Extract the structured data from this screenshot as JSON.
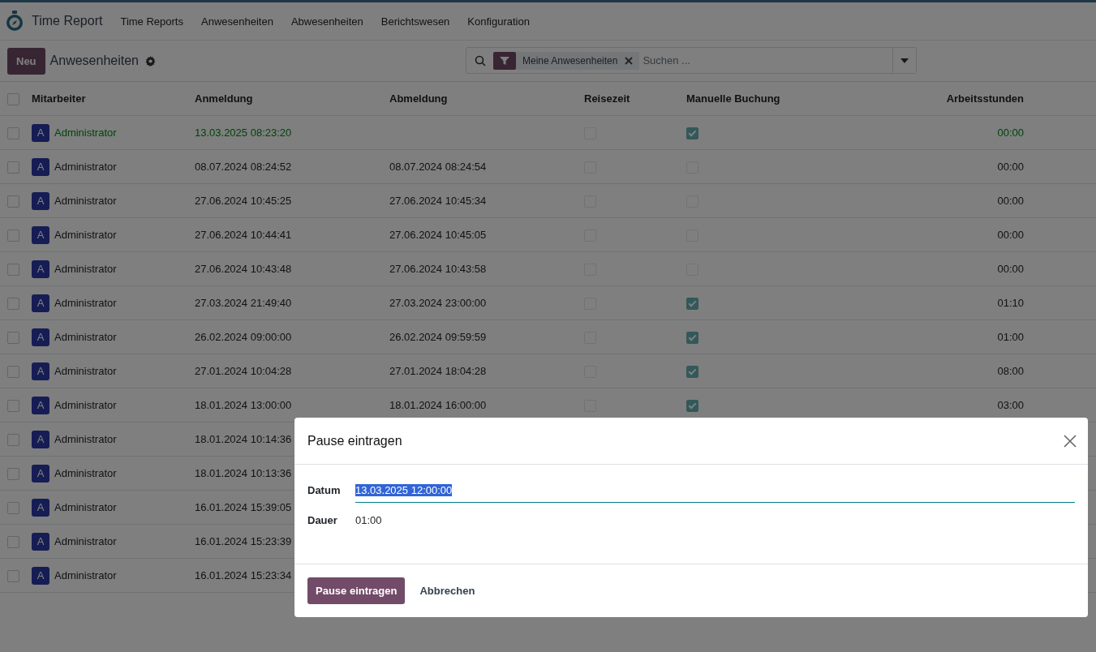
{
  "app": {
    "title": "Time Report"
  },
  "menu": [
    "Time Reports",
    "Anwesenheiten",
    "Abwesenheiten",
    "Berichtswesen",
    "Konfiguration"
  ],
  "control_panel": {
    "new_button": "Neu",
    "title": "Anwesenheiten"
  },
  "search": {
    "facet": "Meine Anwesenheiten",
    "placeholder": "Suchen ..."
  },
  "table": {
    "select_all": false,
    "columns": [
      "Mitarbeiter",
      "Anmeldung",
      "Abmeldung",
      "Reisezeit",
      "Manuelle Buchung",
      "Arbeitsstunden"
    ],
    "rows": [
      {
        "selected": false,
        "avatar": "A",
        "employee": "Administrator",
        "check_in": "13.03.2025 08:23:20",
        "travel": false,
        "manual": true,
        "hours": "00:00",
        "active": true
      },
      {
        "selected": false,
        "avatar": "A",
        "employee": "Administrator",
        "check_in": "08.07.2024 08:24:52",
        "check_out": "08.07.2024 08:24:54",
        "travel": false,
        "manual": false,
        "hours": "00:00",
        "active": false
      },
      {
        "selected": false,
        "avatar": "A",
        "employee": "Administrator",
        "check_in": "27.06.2024 10:45:25",
        "check_out": "27.06.2024 10:45:34",
        "travel": false,
        "manual": false,
        "hours": "00:00",
        "active": false
      },
      {
        "selected": false,
        "avatar": "A",
        "employee": "Administrator",
        "check_in": "27.06.2024 10:44:41",
        "check_out": "27.06.2024 10:45:05",
        "travel": false,
        "manual": false,
        "hours": "00:00",
        "active": false
      },
      {
        "selected": false,
        "avatar": "A",
        "employee": "Administrator",
        "check_in": "27.06.2024 10:43:48",
        "check_out": "27.06.2024 10:43:58",
        "travel": false,
        "manual": false,
        "hours": "00:00",
        "active": false
      },
      {
        "selected": false,
        "avatar": "A",
        "employee": "Administrator",
        "check_in": "27.03.2024 21:49:40",
        "check_out": "27.03.2024 23:00:00",
        "travel": false,
        "manual": true,
        "hours": "01:10",
        "active": false
      },
      {
        "selected": false,
        "avatar": "A",
        "employee": "Administrator",
        "check_in": "26.02.2024 09:00:00",
        "check_out": "26.02.2024 09:59:59",
        "travel": false,
        "manual": true,
        "hours": "01:00",
        "active": false
      },
      {
        "selected": false,
        "avatar": "A",
        "employee": "Administrator",
        "check_in": "27.01.2024 10:04:28",
        "check_out": "27.01.2024 18:04:28",
        "travel": false,
        "manual": true,
        "hours": "08:00",
        "active": false
      },
      {
        "selected": false,
        "avatar": "A",
        "employee": "Administrator",
        "check_in": "18.01.2024 13:00:00",
        "check_out": "18.01.2024 16:00:00",
        "travel": false,
        "manual": true,
        "hours": "03:00",
        "active": false
      },
      {
        "selected": false,
        "avatar": "A",
        "employee": "Administrator",
        "check_in": "18.01.2024 10:14:36",
        "active": false
      },
      {
        "selected": false,
        "avatar": "A",
        "employee": "Administrator",
        "check_in": "18.01.2024 10:13:36",
        "active": false
      },
      {
        "selected": false,
        "avatar": "A",
        "employee": "Administrator",
        "check_in": "16.01.2024 15:39:05",
        "active": false
      },
      {
        "selected": false,
        "avatar": "A",
        "employee": "Administrator",
        "check_in": "16.01.2024 15:23:39",
        "active": false
      },
      {
        "selected": false,
        "avatar": "A",
        "employee": "Administrator",
        "check_in": "16.01.2024 15:23:34",
        "active": false
      }
    ]
  },
  "dialog": {
    "title": "Pause eintragen",
    "fields": [
      {
        "label": "Datum",
        "value": "13.03.2025 12:00:00",
        "kind": "input"
      },
      {
        "label": "Dauer",
        "value": "01:00",
        "kind": "text"
      }
    ],
    "buttons": [
      {
        "label": "Pause eintragen",
        "primary": true
      },
      {
        "label": "Abbrechen",
        "primary": false
      }
    ]
  }
}
